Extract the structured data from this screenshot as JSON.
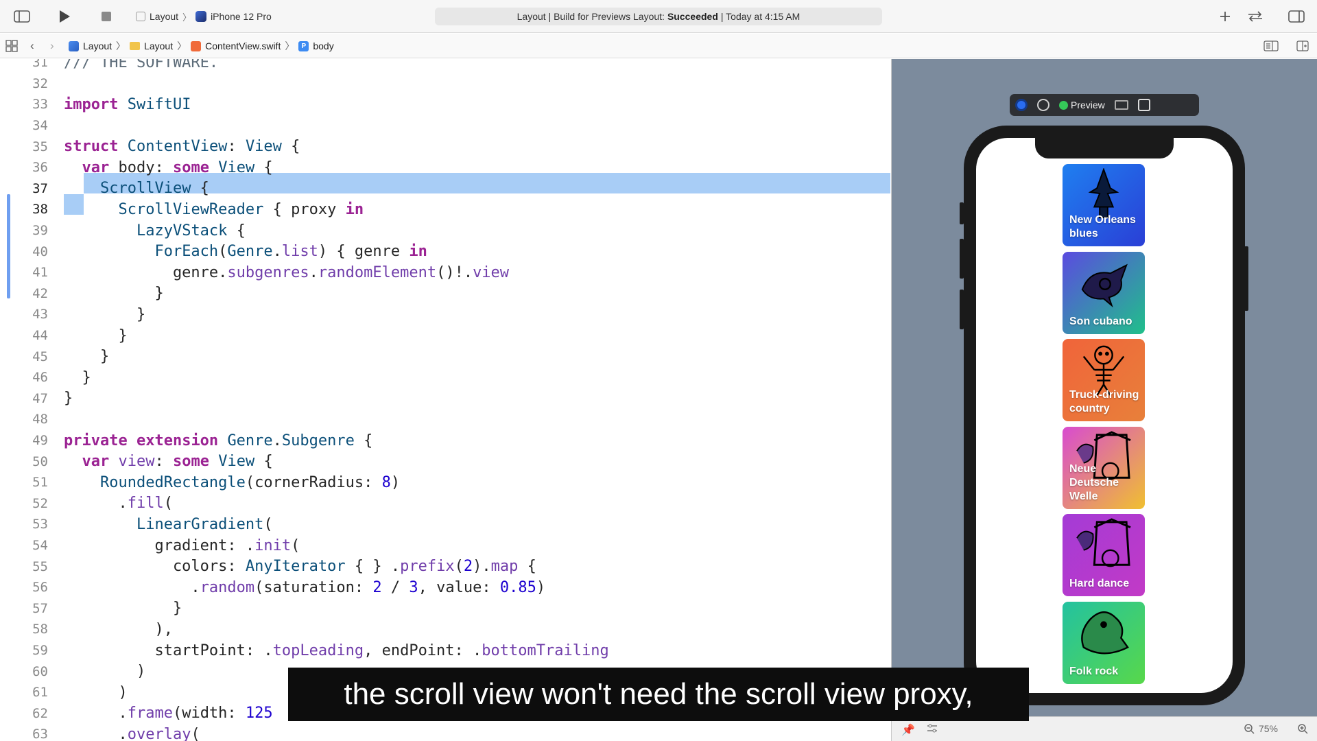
{
  "toolbar": {
    "scheme_project": "Layout",
    "scheme_device": "iPhone 12 Pro",
    "activity_prefix": "Layout | Build for Previews Layout:",
    "activity_status": "Succeeded",
    "activity_suffix": "| Today at 4:15 AM"
  },
  "jumpbar": {
    "crumbs": [
      "Layout",
      "Layout",
      "ContentView.swift",
      "body"
    ]
  },
  "editor": {
    "lines": [
      {
        "n": "31",
        "t": "/// THE SOFTWARE."
      },
      {
        "n": "32",
        "t": ""
      },
      {
        "n": "33",
        "t": "import SwiftUI"
      },
      {
        "n": "34",
        "t": ""
      },
      {
        "n": "35",
        "t": "struct ContentView: View {"
      },
      {
        "n": "36",
        "t": "  var body: some View {"
      },
      {
        "n": "37",
        "t": "    ScrollView {"
      },
      {
        "n": "38",
        "t": "      ScrollViewReader { proxy in"
      },
      {
        "n": "39",
        "t": "        LazyVStack {"
      },
      {
        "n": "40",
        "t": "          ForEach(Genre.list) { genre in"
      },
      {
        "n": "41",
        "t": "            genre.subgenres.randomElement()!.view"
      },
      {
        "n": "42",
        "t": "          }"
      },
      {
        "n": "43",
        "t": "        }"
      },
      {
        "n": "44",
        "t": "      }"
      },
      {
        "n": "45",
        "t": "    }"
      },
      {
        "n": "46",
        "t": "  }"
      },
      {
        "n": "47",
        "t": "}"
      },
      {
        "n": "48",
        "t": ""
      },
      {
        "n": "49",
        "t": "private extension Genre.Subgenre {"
      },
      {
        "n": "50",
        "t": "  var view: some View {"
      },
      {
        "n": "51",
        "t": "    RoundedRectangle(cornerRadius: 8)"
      },
      {
        "n": "52",
        "t": "      .fill("
      },
      {
        "n": "53",
        "t": "        LinearGradient("
      },
      {
        "n": "54",
        "t": "          gradient: .init("
      },
      {
        "n": "55",
        "t": "            colors: AnyIterator { } .prefix(2).map {"
      },
      {
        "n": "56",
        "t": "              .random(saturation: 2 / 3, value: 0.85)"
      },
      {
        "n": "57",
        "t": "            }"
      },
      {
        "n": "58",
        "t": "          ),"
      },
      {
        "n": "59",
        "t": "          startPoint: .topLeading, endPoint: .bottomTrailing"
      },
      {
        "n": "60",
        "t": "        )"
      },
      {
        "n": "61",
        "t": "      )"
      },
      {
        "n": "62",
        "t": "      .frame(width: 125"
      },
      {
        "n": "63",
        "t": "      .overlay("
      }
    ]
  },
  "preview": {
    "label": "Preview",
    "zoom": "75%",
    "cards": [
      {
        "label": "New Orleans blues",
        "c1": "#1f7ff0",
        "c2": "#2a3fd6"
      },
      {
        "label": "Son cubano",
        "c1": "#5b4be0",
        "c2": "#20c08a"
      },
      {
        "label": "Truck-driving country",
        "c1": "#f0643a",
        "c2": "#e8803a"
      },
      {
        "label": "Neue Deutsche Welle",
        "c1": "#d84bd0",
        "c2": "#f0c030"
      },
      {
        "label": "Hard dance",
        "c1": "#a43bd6",
        "c2": "#c23ac6"
      },
      {
        "label": "Folk rock",
        "c1": "#23c2a0",
        "c2": "#58d84a"
      }
    ]
  },
  "caption": "the scroll view won't need the scroll view proxy,"
}
